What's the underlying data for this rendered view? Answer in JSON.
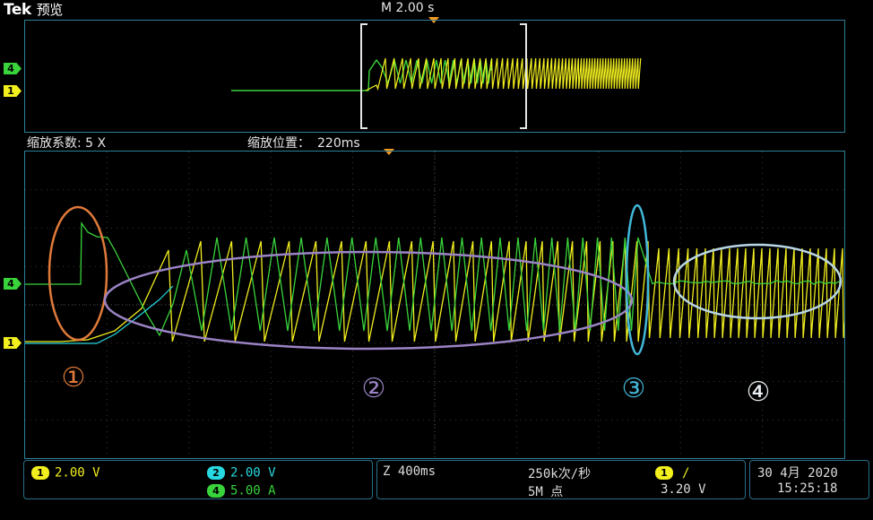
{
  "header": {
    "brand": "Tek",
    "mode": "预览",
    "timebase": "M 2.00 s"
  },
  "zoom": {
    "factor": "缩放系数: 5 X",
    "position_label": "缩放位置：",
    "position_value": "220ms"
  },
  "channel_markers": {
    "ch4": "4",
    "ch1": "1"
  },
  "annotations": [
    "①",
    "②",
    "③",
    "④"
  ],
  "colors": {
    "ch1": "#f2ef1e",
    "ch2": "#27d8e0",
    "ch4": "#39d33b",
    "trigger": "#f39a1f",
    "ann1": "#e07a3a",
    "ann2": "#9b84c6",
    "ann3": "#42b7d9",
    "ann4": "#e8eef2"
  },
  "status": {
    "ch1": {
      "num": "1",
      "scale": "2.00 V"
    },
    "ch2": {
      "num": "2",
      "scale": "2.00 V"
    },
    "ch4": {
      "num": "4",
      "scale": "5.00 A"
    },
    "zoom_time": "Z 400ms",
    "sample_rate": "250k次/秒",
    "record_length": "5M 点",
    "trigger": {
      "source": "1",
      "slope": "/",
      "level": "3.20 V"
    },
    "date": "30 4月 2020",
    "time": "15:25:18"
  }
}
